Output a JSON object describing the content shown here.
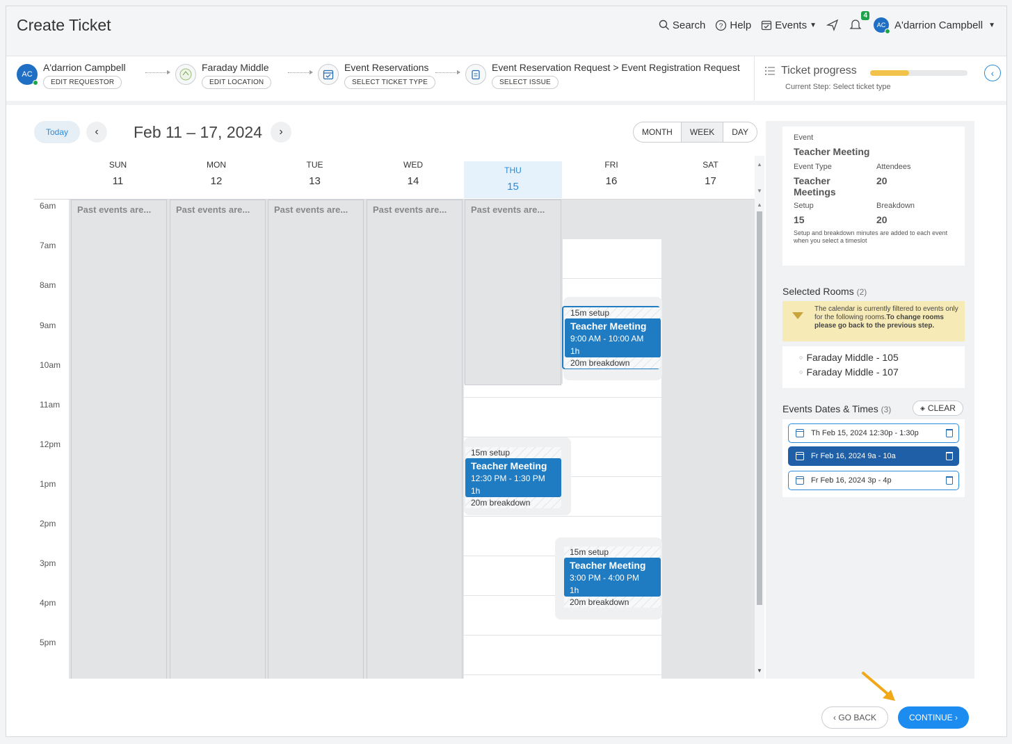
{
  "header": {
    "title": "Create Ticket",
    "search": "Search",
    "help": "Help",
    "events": "Events",
    "notification_count": "4",
    "user_initials": "AC",
    "user_name": "A'darrion Campbell"
  },
  "steps": [
    {
      "label": "A'darrion Campbell",
      "button": "EDIT REQUESTOR",
      "avatar": "AC"
    },
    {
      "label": "Faraday Middle",
      "button": "EDIT LOCATION"
    },
    {
      "label": "Event Reservations",
      "button": "SELECT TICKET TYPE"
    },
    {
      "label": "Event Reservation Request  >  Event Registration Request",
      "button": "SELECT ISSUE"
    }
  ],
  "progress": {
    "title": "Ticket progress",
    "current_step": "Current Step: Select ticket type",
    "fraction": 0.4,
    "color": "#f2c24a"
  },
  "calendar": {
    "today_label": "Today",
    "range": "Feb 11 – 17, 2024",
    "views": [
      "MONTH",
      "WEEK",
      "DAY"
    ],
    "active_view": "WEEK",
    "days": [
      {
        "name": "SUN",
        "num": "11"
      },
      {
        "name": "MON",
        "num": "12"
      },
      {
        "name": "TUE",
        "num": "13"
      },
      {
        "name": "WED",
        "num": "14"
      },
      {
        "name": "THU",
        "num": "15"
      },
      {
        "name": "FRI",
        "num": "16"
      },
      {
        "name": "SAT",
        "num": "17"
      }
    ],
    "times": [
      "6am",
      "7am",
      "8am",
      "9am",
      "10am",
      "11am",
      "12pm",
      "1pm",
      "2pm",
      "3pm",
      "4pm",
      "5pm"
    ],
    "past_label": "Past events are...",
    "events": [
      {
        "setup": "15m setup",
        "title": "Teacher Meeting",
        "time": "9:00 AM - 10:00 AM",
        "duration": "1h",
        "breakdown": "20m breakdown"
      },
      {
        "setup": "15m setup",
        "title": "Teacher Meeting",
        "time": "12:30 PM - 1:30 PM",
        "duration": "1h",
        "breakdown": "20m breakdown"
      },
      {
        "setup": "15m setup",
        "title": "Teacher Meeting",
        "time": "3:00 PM - 4:00 PM",
        "duration": "1h",
        "breakdown": "20m breakdown"
      }
    ]
  },
  "sidebar": {
    "event_label": "Event",
    "event_name": "Teacher Meeting",
    "event_type_label": "Event Type",
    "event_type": "Teacher Meetings",
    "attendees_label": "Attendees",
    "attendees": "20",
    "setup_label": "Setup",
    "setup": "15",
    "breakdown_label": "Breakdown",
    "breakdown": "20",
    "note": "Setup and breakdown minutes are added to each event when you select a timeslot",
    "rooms_title": "Selected Rooms",
    "rooms_count": "(2)",
    "filter_note": "The calendar is currently filtered to events only for the following rooms.",
    "filter_note_bold": "To change rooms please go back to the previous step.",
    "rooms": [
      "Faraday Middle - 105",
      "Faraday Middle - 107"
    ],
    "dates_title": "Events Dates & Times",
    "dates_count": "(3)",
    "clear_label": "CLEAR",
    "dates": [
      "Th Feb 15, 2024 12:30p - 1:30p",
      "Fr Feb 16, 2024 9a - 10a",
      "Fr Feb 16, 2024 3p - 4p"
    ]
  },
  "footer": {
    "go_back": "‹  GO BACK",
    "continue": "CONTINUE ›"
  }
}
